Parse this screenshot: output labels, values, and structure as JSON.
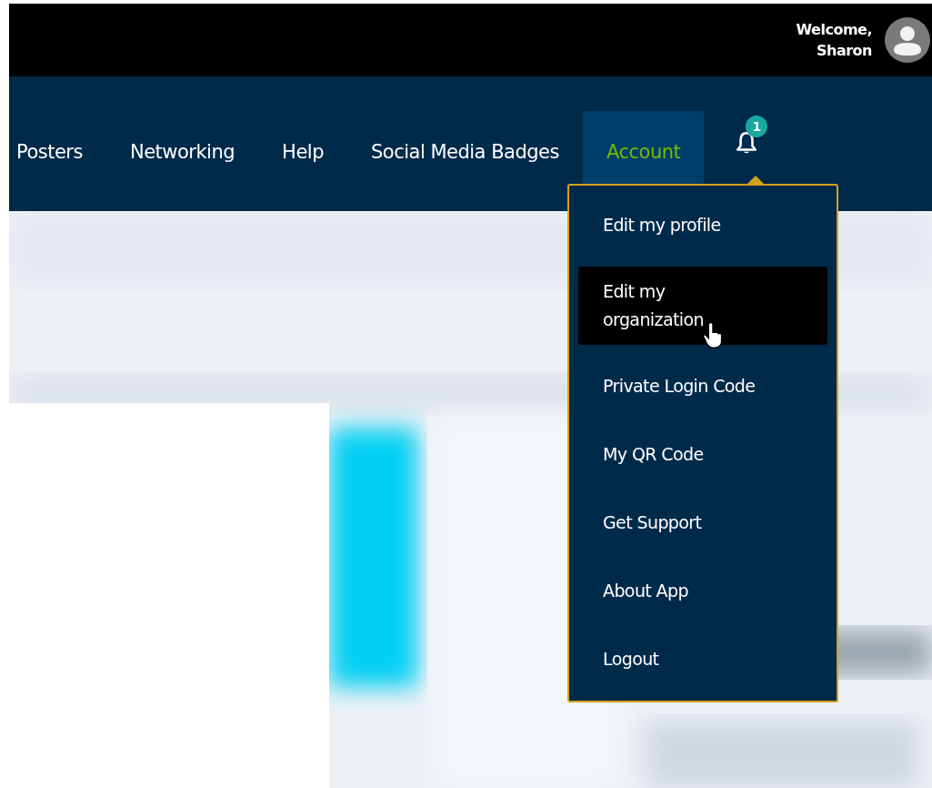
{
  "top_bar": {
    "welcome": "Welcome,",
    "user": "Sharon"
  },
  "nav": {
    "items": [
      {
        "label": "Posters",
        "selected": false
      },
      {
        "label": "Networking",
        "selected": false
      },
      {
        "label": "Help",
        "selected": false
      },
      {
        "label": "Social Media Badges",
        "selected": false
      },
      {
        "label": "Account",
        "selected": true
      }
    ],
    "notifications": {
      "count": "1"
    }
  },
  "account_menu": {
    "items": [
      {
        "label": "Edit my profile",
        "selected": false
      },
      {
        "label": "Edit my organization",
        "selected": true
      },
      {
        "label": "Private Login Code",
        "selected": false
      },
      {
        "label": "My QR Code",
        "selected": false
      },
      {
        "label": "Get Support",
        "selected": false
      },
      {
        "label": "About App",
        "selected": false
      },
      {
        "label": "Logout",
        "selected": false
      }
    ]
  }
}
